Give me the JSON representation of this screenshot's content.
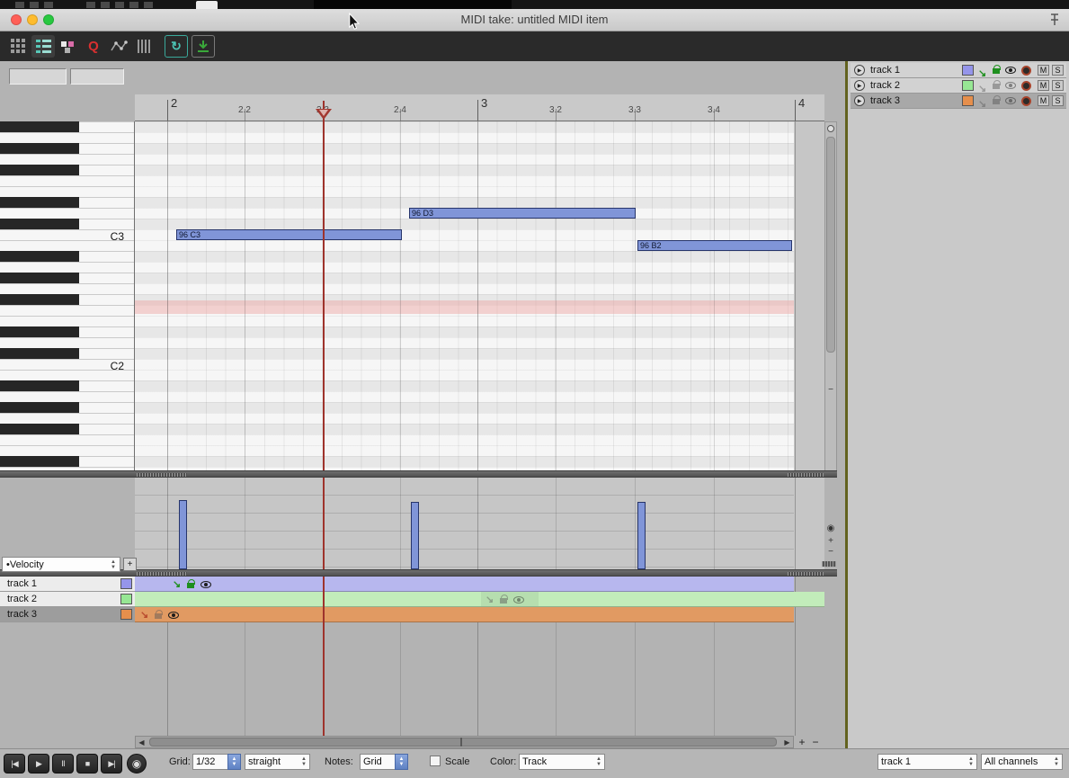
{
  "window": {
    "title": "MIDI take: untitled MIDI item"
  },
  "toolbar": {
    "icons": [
      {
        "name": "note-grid-view-icon"
      },
      {
        "name": "named-notes-view-icon"
      },
      {
        "name": "color-palette-icon"
      },
      {
        "name": "quantize-icon",
        "glyph": "Q"
      },
      {
        "name": "envelope-points-icon"
      },
      {
        "name": "event-lines-icon"
      },
      {
        "name": "sync-playback-icon",
        "glyph": "↻"
      },
      {
        "name": "import-notes-icon"
      }
    ]
  },
  "ruler": {
    "ticks": [
      "2",
      "2.2",
      "2.3",
      "2.4",
      "3",
      "3.2",
      "3.3",
      "3.4",
      "4"
    ]
  },
  "piano": {
    "key_labels": [
      "C3",
      "C2"
    ]
  },
  "notes": [
    {
      "label": "96 C3",
      "velocity": 96,
      "pitch": "C3"
    },
    {
      "label": "96 D3",
      "velocity": 96,
      "pitch": "D3"
    },
    {
      "label": "96 B2",
      "velocity": 96,
      "pitch": "B2"
    }
  ],
  "velocity_lane": {
    "selector": "•Velocity",
    "add_button": "+"
  },
  "tracks": [
    {
      "name": "track 1",
      "color": "#9595ea",
      "lane_color": "#b7b7ee"
    },
    {
      "name": "track 2",
      "color": "#97e794",
      "lane_color": "#c2ecba"
    },
    {
      "name": "track 3",
      "color": "#e68f4c",
      "lane_color": "#e19a62"
    }
  ],
  "right_panel": {
    "mute_label": "M",
    "solo_label": "S"
  },
  "transport": [
    {
      "name": "go-to-start",
      "glyph": "|◀"
    },
    {
      "name": "play",
      "glyph": "▶"
    },
    {
      "name": "pause",
      "glyph": "Ⅱ"
    },
    {
      "name": "stop",
      "glyph": "■"
    },
    {
      "name": "go-to-end",
      "glyph": "▶|"
    },
    {
      "name": "metronome",
      "glyph": "◉"
    }
  ],
  "bottom_bar": {
    "grid_label": "Grid:",
    "grid_value": "1/32",
    "swing_value": "straight",
    "notes_label": "Notes:",
    "notes_value": "Grid",
    "scale_label": "Scale",
    "color_label": "Color:",
    "color_value": "Track",
    "track_filter": "track 1",
    "channel_filter": "All channels"
  },
  "scrollbar": {
    "zoom_in": "+",
    "zoom_out": "−"
  },
  "colors": {
    "playhead": "#9e332c",
    "note_fill": "#8095d8",
    "pink_row": "#eeaaa8"
  }
}
